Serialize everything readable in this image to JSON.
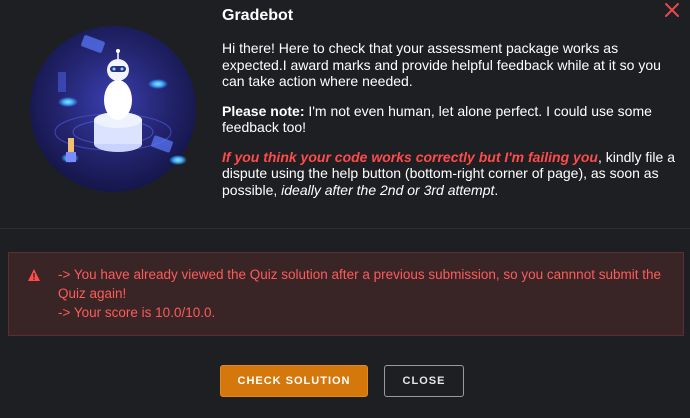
{
  "dialog": {
    "title": "Gradebot",
    "intro": "Hi there! Here to check that your assessment package works as expected.I award marks and provide helpful feedback while at it so you can take action where needed.",
    "note_label": "Please note:",
    "note_text": " I'm not even human, let alone perfect. I could use some feedback too!",
    "dispute_red": "If you think your code works correctly but I'm failing you",
    "dispute_text": ", kindly file a dispute using the help button (bottom-right corner of page), as soon as possible, ",
    "dispute_italic": "ideally after the 2nd or 3rd attempt",
    "dispute_end": ".",
    "close_icon": "close-icon",
    "illustration_icon": "robot-illustration"
  },
  "alert": {
    "icon": "warning-icon",
    "line1": "-> You have already viewed the Quiz solution after a previous submission, so you cannnot submit the Quiz again!",
    "line2": "-> Your score is 10.0/10.0."
  },
  "buttons": {
    "check_solution": "CHECK SOLUTION",
    "close": "CLOSE"
  },
  "colors": {
    "accent": "#d4780c",
    "danger": "#ff4b4b",
    "background": "#1e1f22"
  }
}
